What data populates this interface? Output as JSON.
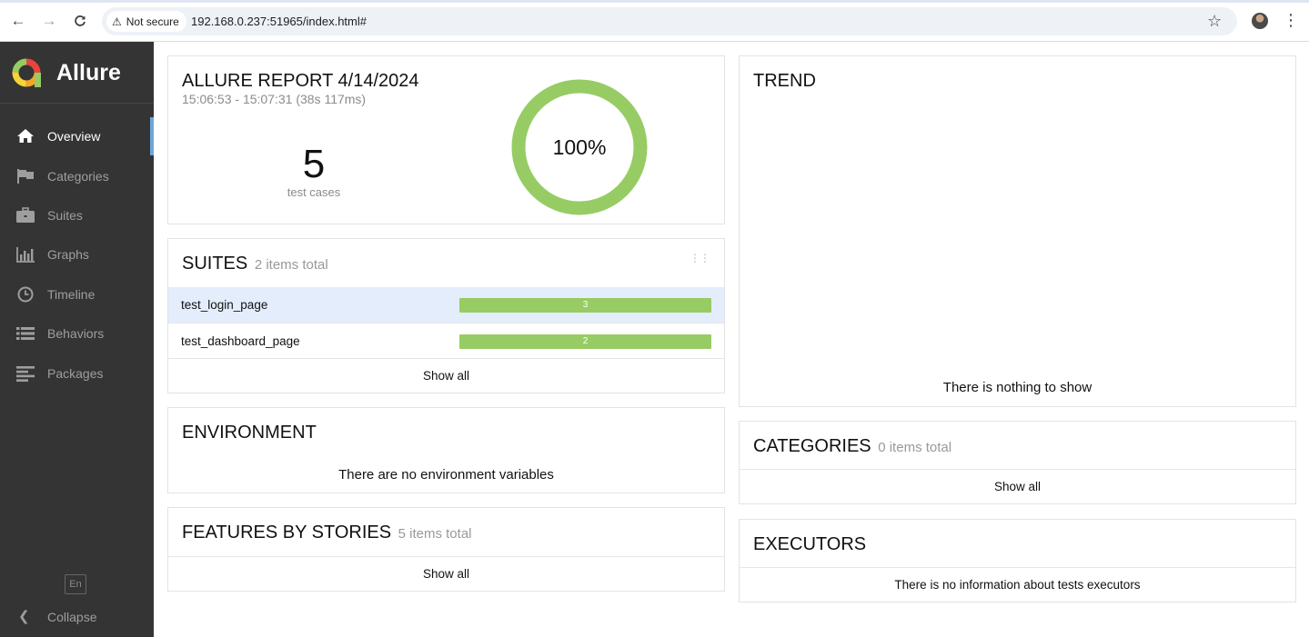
{
  "browser": {
    "security_label": "Not secure",
    "url": "192.168.0.237:51965/index.html#"
  },
  "sidebar": {
    "brand": "Allure",
    "items": [
      {
        "label": "Overview",
        "icon": "home-icon",
        "active": true
      },
      {
        "label": "Categories",
        "icon": "flag-icon",
        "active": false
      },
      {
        "label": "Suites",
        "icon": "briefcase-icon",
        "active": false
      },
      {
        "label": "Graphs",
        "icon": "bar-chart-icon",
        "active": false
      },
      {
        "label": "Timeline",
        "icon": "clock-icon",
        "active": false
      },
      {
        "label": "Behaviors",
        "icon": "list-icon",
        "active": false
      },
      {
        "label": "Packages",
        "icon": "align-left-icon",
        "active": false
      }
    ],
    "language": "En",
    "collapse_label": "Collapse"
  },
  "summary": {
    "title": "ALLURE REPORT 4/14/2024",
    "time_range": "15:06:53 - 15:07:31 (38s 117ms)",
    "test_cases_count": "5",
    "test_cases_label": "test cases",
    "pass_rate": "100%"
  },
  "suites": {
    "title": "SUITES",
    "count_text": "2 items total",
    "rows": [
      {
        "name": "test_login_page",
        "passed": "3"
      },
      {
        "name": "test_dashboard_page",
        "passed": "2"
      }
    ],
    "show_all": "Show all"
  },
  "environment": {
    "title": "ENVIRONMENT",
    "message": "There are no environment variables"
  },
  "features": {
    "title": "FEATURES BY STORIES",
    "count_text": "5 items total",
    "show_all": "Show all"
  },
  "trend": {
    "title": "TREND",
    "message": "There is nothing to show"
  },
  "categories": {
    "title": "CATEGORIES",
    "count_text": "0 items total",
    "show_all": "Show all"
  },
  "executors": {
    "title": "EXECUTORS",
    "message": "There is no information about tests executors"
  },
  "colors": {
    "passed": "#97cc64",
    "sidebar_bg": "#343434",
    "active_indicator": "#6ea6d9",
    "highlight_row": "#e3edfb"
  }
}
